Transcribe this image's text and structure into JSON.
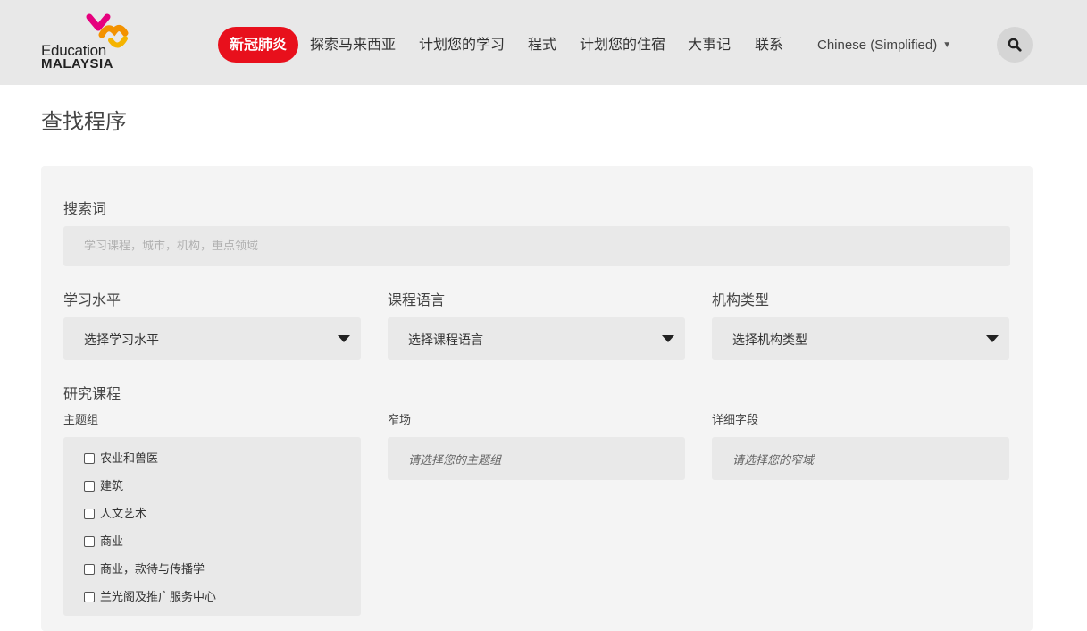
{
  "header": {
    "logo": {
      "line1": "Education",
      "line2": "MALAYSIA"
    },
    "nav": {
      "covid": "新冠肺炎",
      "explore": "探索马来西亚",
      "plan_study": "计划您的学习",
      "programs": "程式",
      "plan_accommodation": "计划您的住宿",
      "events": "大事记",
      "contact": "联系"
    },
    "language": "Chinese (Simplified)",
    "colors": {
      "accent": "#e8101c",
      "logo_magenta": "#e6007e",
      "logo_orange": "#f39200"
    }
  },
  "page": {
    "title": "查找程序"
  },
  "form": {
    "search": {
      "label": "搜索词",
      "placeholder": "学习课程，城市，机构，重点领域"
    },
    "study_level": {
      "label": "学习水平",
      "value": "选择学习水平"
    },
    "course_language": {
      "label": "课程语言",
      "value": "选择课程语言"
    },
    "institution_type": {
      "label": "机构类型",
      "value": "选择机构类型"
    },
    "study_course": {
      "label": "研究课程"
    },
    "subject_group": {
      "label": "主题组",
      "items": [
        "农业和兽医",
        "建筑",
        "人文艺术",
        "商业",
        "商业，款待与传播学",
        "兰光阁及推广服务中心"
      ]
    },
    "narrow_field": {
      "label": "窄场",
      "placeholder": "请选择您的主题组"
    },
    "detailed_field": {
      "label": "详细字段",
      "placeholder": "请选择您的窄域"
    }
  }
}
